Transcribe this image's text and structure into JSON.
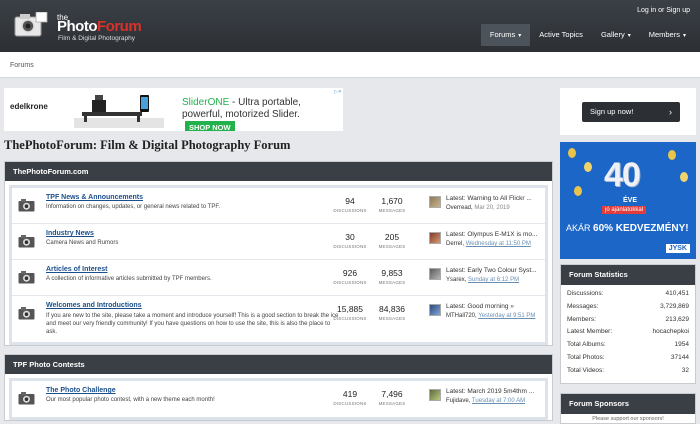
{
  "header": {
    "logo_small": "the",
    "logo_main_a": "Photo",
    "logo_main_b": "Forum",
    "logo_tagline": "Film & Digital Photography",
    "login": "Log in or Sign up",
    "nav": [
      {
        "label": "Forums",
        "chevron": "▾"
      },
      {
        "label": "Active Topics",
        "chevron": ""
      },
      {
        "label": "Gallery",
        "chevron": "▾"
      },
      {
        "label": "Members",
        "chevron": "▾"
      }
    ]
  },
  "breadcrumb": "Forums",
  "ad_top": {
    "brand": "edelkrone",
    "product": "SliderONE",
    "text": " - Ultra portable, powerful, motorized Slider.",
    "cta": "SHOP NOW"
  },
  "page_title": "ThePhotoForum: Film & Digital Photography Forum",
  "sections": [
    {
      "title": "ThePhotoForum.com",
      "rows": [
        {
          "title": "TPF News & Announcements",
          "desc": "Information on changes, updates, or general news related to TPF.",
          "discussions": "94",
          "messages": "1,670",
          "latest": "Latest: Warning to All Flickr ...",
          "user": "Overread",
          "date": "Mar 20, 2019"
        },
        {
          "title": "Industry News",
          "desc": "Camera News and Rumors",
          "discussions": "30",
          "messages": "205",
          "latest": "Latest: Olympus E-M1X is mo...",
          "user": "Derrel",
          "date": "Wednesday at 11:50 PM"
        },
        {
          "title": "Articles of Interest",
          "desc": "A collection of informative articles submitted by TPF members.",
          "discussions": "926",
          "messages": "9,853",
          "latest": "Latest: Early Two Colour Syst...",
          "user": "Ysarex",
          "date": "Sunday at 6:12 PM"
        },
        {
          "title": "Welcomes and Introductions",
          "desc": "If you are new to the site, please take a moment and introduce yourself! This is a good section to break the ice and meet our very friendly community! If you have questions on how to use the site, this is also the place to ask.",
          "discussions": "15,885",
          "messages": "84,836",
          "latest": "Latest: Good morning",
          "user": "MTHall720",
          "date": "Yesterday at 9:51 PM"
        }
      ]
    },
    {
      "title": "TPF Photo Contests",
      "rows": [
        {
          "title": "The Photo Challenge",
          "desc": "Our most popular photo contest, with a new theme each month!",
          "discussions": "419",
          "messages": "7,496",
          "latest": "Latest: March 2019 5m4thm ...",
          "user": "Fujidave",
          "date": "Tuesday at 7:00 AM"
        }
      ]
    }
  ],
  "labels": {
    "discussions": "DISCUSSIONS",
    "messages": "MESSAGES"
  },
  "sidebar": {
    "signup": "Sign up now!",
    "ad": {
      "number": "40",
      "eve": "ÉVE",
      "sub": "jó ajánlatokkal",
      "deal_prefix": "AKÁR ",
      "deal_bold": "60% KEDVEZMÉNY!",
      "brand": "JYSK"
    },
    "stats_title": "Forum Statistics",
    "stats": [
      {
        "k": "Discussions:",
        "v": "410,451"
      },
      {
        "k": "Messages:",
        "v": "3,729,869"
      },
      {
        "k": "Members:",
        "v": "213,629"
      },
      {
        "k": "Latest Member:",
        "v": "hocachepkoi"
      },
      {
        "k": "Total Albums:",
        "v": "1954"
      },
      {
        "k": "Total Photos:",
        "v": "37144"
      },
      {
        "k": "Total Videos:",
        "v": "32"
      }
    ],
    "sponsors_title": "Forum Sponsors",
    "sponsors_text": "Please support our sponsors!"
  }
}
